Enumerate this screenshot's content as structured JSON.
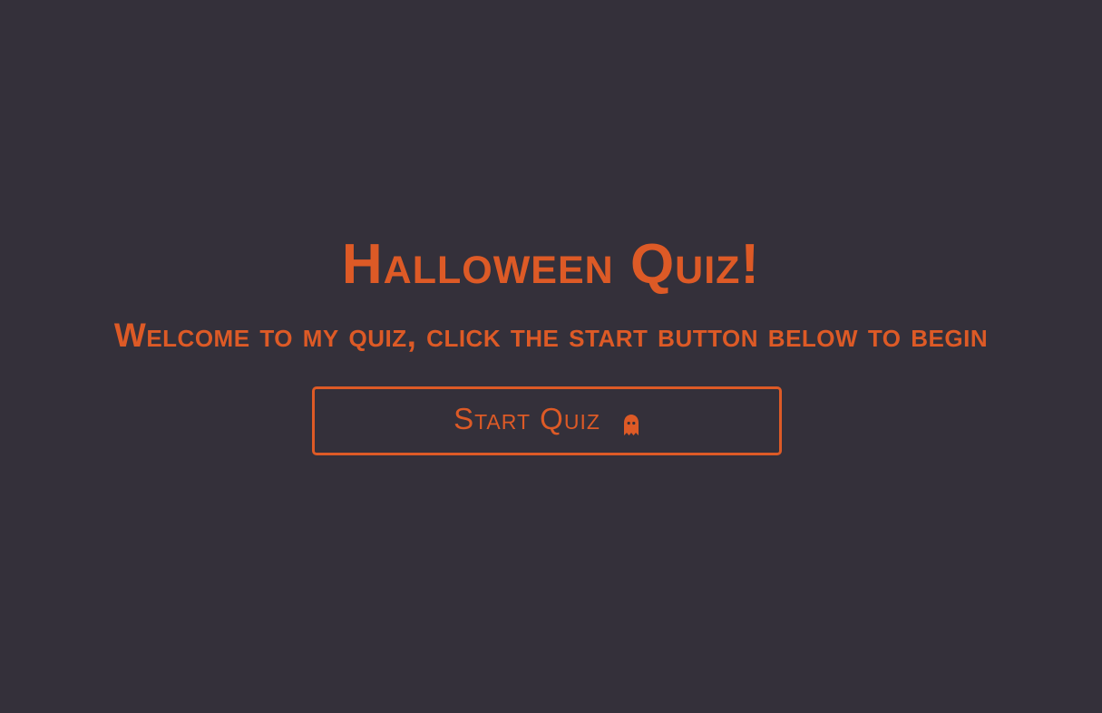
{
  "title": "Halloween Quiz!",
  "subtitle": "Welcome to my quiz, click the start button below to begin",
  "start_button": {
    "label": "Start Quiz",
    "icon": "ghost-icon"
  },
  "colors": {
    "background": "#34303a",
    "accent": "#dd5a26"
  }
}
